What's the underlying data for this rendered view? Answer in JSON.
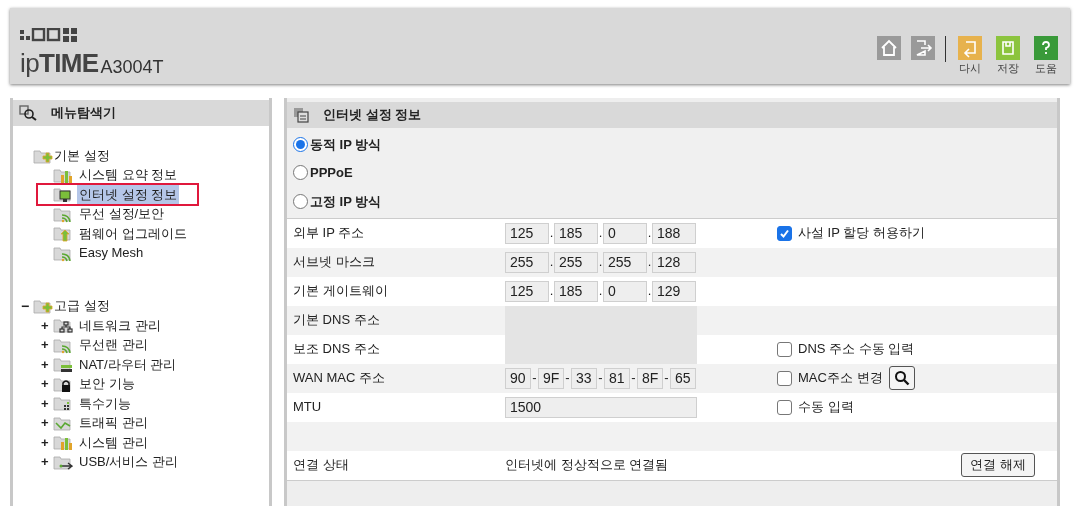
{
  "header": {
    "logo": "ip**TIME**",
    "model": "A3004T",
    "nav_icons": [
      {
        "kind": "home"
      },
      {
        "kind": "logout"
      }
    ],
    "actions": [
      {
        "kind": "undo",
        "label": "다시"
      },
      {
        "kind": "save",
        "label": "저장"
      },
      {
        "kind": "help",
        "label": "도움"
      }
    ]
  },
  "sidebar": {
    "title": "메뉴탐색기",
    "tree": [
      {
        "label": "기본 설정",
        "kind": "folder-plus",
        "children": [
          {
            "label": "시스템 요약 정보",
            "kind": "chart",
            "selected": false
          },
          {
            "label": "인터넷 설정 정보",
            "kind": "monitor",
            "selected": true
          },
          {
            "label": "무선 설정/보안",
            "kind": "wifi",
            "selected": false
          },
          {
            "label": "펌웨어 업그레이드",
            "kind": "upload",
            "selected": false
          },
          {
            "label": "Easy Mesh",
            "kind": "wifi",
            "selected": false
          }
        ]
      },
      {
        "label": "고급 설정",
        "kind": "folder-plus",
        "toggle": "−",
        "children": [
          {
            "label": "네트워크 관리",
            "kind": "network",
            "toggle": "+"
          },
          {
            "label": "무선랜 관리",
            "kind": "wifi",
            "toggle": "+"
          },
          {
            "label": "NAT/라우터 관리",
            "kind": "router",
            "toggle": "+"
          },
          {
            "label": "보안 기능",
            "kind": "lock",
            "toggle": "+"
          },
          {
            "label": "특수기능",
            "kind": "dots",
            "toggle": "+"
          },
          {
            "label": "트래픽 관리",
            "kind": "traffic",
            "toggle": "+"
          },
          {
            "label": "시스템 관리",
            "kind": "chart",
            "toggle": "+"
          },
          {
            "label": "USB/서비스 관리",
            "kind": "usb",
            "toggle": "+"
          }
        ]
      }
    ]
  },
  "main": {
    "title": "인터넷 설정 정보",
    "connection_types": [
      {
        "label": "동적 IP 방식",
        "selected": true
      },
      {
        "label": "PPPoE",
        "selected": false
      },
      {
        "label": "고정 IP 방식",
        "selected": false
      }
    ],
    "rows": [
      {
        "label": "외부 IP 주소",
        "kind": "ip",
        "separator": ".",
        "parts": [
          "125",
          "185",
          "0",
          "188"
        ],
        "option": {
          "label": "사설 IP 할당 허용하기",
          "checked": true
        }
      },
      {
        "label": "서브넷 마스크",
        "kind": "ip",
        "separator": ".",
        "parts": [
          "255",
          "255",
          "255",
          "128"
        ]
      },
      {
        "label": "기본 게이트웨이",
        "kind": "ip",
        "separator": ".",
        "parts": [
          "125",
          "185",
          "0",
          "129"
        ]
      },
      {
        "label": "기본 DNS 주소",
        "kind": "blurred"
      },
      {
        "label": "보조 DNS 주소",
        "kind": "blurred",
        "option": {
          "label": "DNS 주소 수동 입력",
          "checked": false
        }
      },
      {
        "label": "WAN MAC 주소",
        "kind": "mac",
        "separator": "-",
        "parts": [
          "90",
          "9F",
          "33",
          "81",
          "8F",
          "65"
        ],
        "option": {
          "label": "MAC주소 변경",
          "checked": false,
          "search_button": true
        }
      },
      {
        "label": "MTU",
        "kind": "text",
        "value": "1500",
        "option": {
          "label": "수동 입력",
          "checked": false
        }
      }
    ],
    "status": {
      "label": "연결 상태",
      "value": "인터넷에 정상적으로 연결됨",
      "button": "연결 해제"
    }
  }
}
